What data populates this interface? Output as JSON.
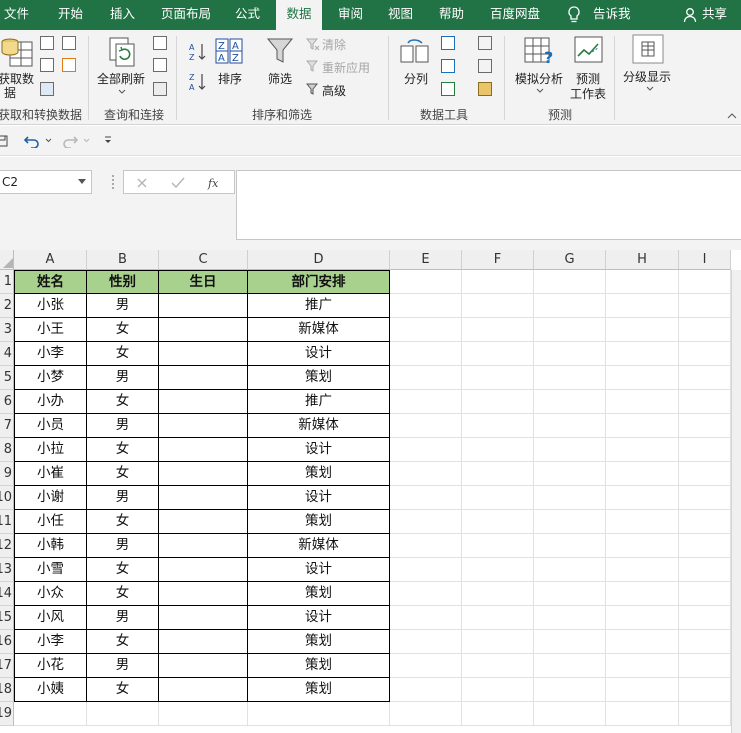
{
  "ribbon_tabs": [
    "文件",
    "开始",
    "插入",
    "页面布局",
    "公式",
    "数据",
    "审阅",
    "视图",
    "帮助",
    "百度网盘"
  ],
  "active_tab": "数据",
  "tell_me": "告诉我",
  "share": "共享",
  "ribbon": {
    "get_data": {
      "line1": "获取数",
      "line2": "据",
      "group": "获取和转换数据"
    },
    "refresh_all": {
      "label": "全部刷新",
      "group": "查询和连接"
    },
    "sort": {
      "label": "排序"
    },
    "filter": {
      "label": "筛选"
    },
    "clear": {
      "label": "清除"
    },
    "reapply": {
      "label": "重新应用"
    },
    "advanced": {
      "label": "高级"
    },
    "sort_filter_group": "排序和筛选",
    "text_to_columns": {
      "label": "分列"
    },
    "data_tools_group": "数据工具",
    "what_if": {
      "label": "模拟分析"
    },
    "forecast_sheet": {
      "line1": "预测",
      "line2": "工作表"
    },
    "forecast_group": "预测",
    "outline": {
      "label": "分级显示"
    }
  },
  "name_box": "C2",
  "formula_value": "",
  "columns": [
    "A",
    "B",
    "C",
    "D",
    "E",
    "F",
    "G",
    "H",
    "I"
  ],
  "rows": [
    "1",
    "2",
    "3",
    "4",
    "5",
    "6",
    "7",
    "8",
    "9",
    "10",
    "11",
    "12",
    "13",
    "14",
    "15",
    "16",
    "17",
    "18",
    "19"
  ],
  "table": {
    "headers": [
      "姓名",
      "性别",
      "生日",
      "部门安排"
    ],
    "rows": [
      [
        "小张",
        "男",
        "",
        "推广"
      ],
      [
        "小王",
        "女",
        "",
        "新媒体"
      ],
      [
        "小李",
        "女",
        "",
        "设计"
      ],
      [
        "小梦",
        "男",
        "",
        "策划"
      ],
      [
        "小办",
        "女",
        "",
        "推广"
      ],
      [
        "小员",
        "男",
        "",
        "新媒体"
      ],
      [
        "小拉",
        "女",
        "",
        "设计"
      ],
      [
        "小崔",
        "女",
        "",
        "策划"
      ],
      [
        "小谢",
        "男",
        "",
        "设计"
      ],
      [
        "小任",
        "女",
        "",
        "策划"
      ],
      [
        "小韩",
        "男",
        "",
        "新媒体"
      ],
      [
        "小雪",
        "女",
        "",
        "设计"
      ],
      [
        "小众",
        "女",
        "",
        "策划"
      ],
      [
        "小风",
        "男",
        "",
        "设计"
      ],
      [
        "小李",
        "女",
        "",
        "策划"
      ],
      [
        "小花",
        "男",
        "",
        "策划"
      ],
      [
        "小姨",
        "女",
        "",
        "策划"
      ]
    ]
  },
  "colors": {
    "ribbon_green": "#217346",
    "header_fill": "#a9d18e"
  }
}
